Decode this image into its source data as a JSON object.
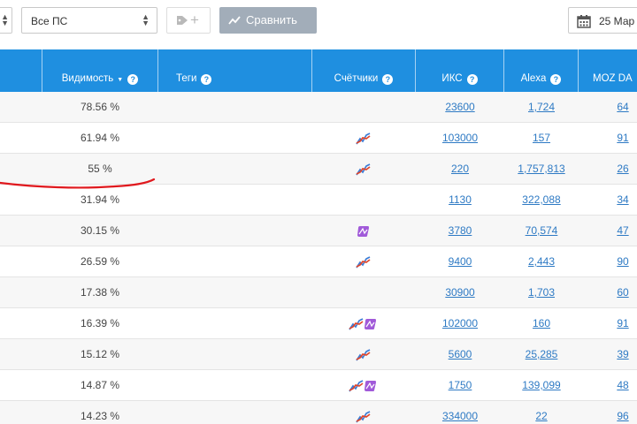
{
  "toolbar": {
    "search_engine_select": {
      "value": "Все ПС"
    },
    "compare_button": {
      "label": "Сравнить"
    },
    "date_button": {
      "label": "25 Мар"
    }
  },
  "table": {
    "columns": [
      {
        "key": "visibility",
        "label": "Видимость",
        "sortable": true
      },
      {
        "key": "tags",
        "label": "Теги"
      },
      {
        "key": "counters",
        "label": "Счётчики"
      },
      {
        "key": "iks",
        "label": "ИКС"
      },
      {
        "key": "alexa",
        "label": "Alexa"
      },
      {
        "key": "moz",
        "label": "MOZ DA"
      }
    ],
    "rows": [
      {
        "visibility": "78.56 %",
        "counters": [],
        "iks": "23600",
        "alexa": "1,724",
        "moz": "64"
      },
      {
        "visibility": "61.94 %",
        "counters": [
          "stats-chart-icon"
        ],
        "iks": "103000",
        "alexa": "157",
        "moz": "91"
      },
      {
        "visibility": "55 %",
        "counters": [
          "stats-chart-icon"
        ],
        "iks": "220",
        "alexa": "1,757,813",
        "moz": "26"
      },
      {
        "visibility": "31.94 %",
        "counters": [],
        "iks": "1130",
        "alexa": "322,088",
        "moz": "34"
      },
      {
        "visibility": "30.15 %",
        "counters": [
          "metrika-icon"
        ],
        "iks": "3780",
        "alexa": "70,574",
        "moz": "47"
      },
      {
        "visibility": "26.59 %",
        "counters": [
          "stats-chart-icon"
        ],
        "iks": "9400",
        "alexa": "2,443",
        "moz": "90"
      },
      {
        "visibility": "17.38 %",
        "counters": [],
        "iks": "30900",
        "alexa": "1,703",
        "moz": "60"
      },
      {
        "visibility": "16.39 %",
        "counters": [
          "stats-chart-icon",
          "metrika-icon"
        ],
        "iks": "102000",
        "alexa": "160",
        "moz": "91"
      },
      {
        "visibility": "15.12 %",
        "counters": [
          "stats-chart-icon"
        ],
        "iks": "5600",
        "alexa": "25,285",
        "moz": "39"
      },
      {
        "visibility": "14.87 %",
        "counters": [
          "stats-chart-icon",
          "metrika-icon"
        ],
        "iks": "1750",
        "alexa": "139,099",
        "moz": "48"
      },
      {
        "visibility": "14.23 %",
        "counters": [
          "stats-chart-icon"
        ],
        "iks": "334000",
        "alexa": "22",
        "moz": "96"
      }
    ]
  },
  "colors": {
    "header_bg": "#1f8fe0",
    "link": "#2e7ac4",
    "compare_button_bg": "#a2adb9",
    "annotation": "#e0191e"
  }
}
